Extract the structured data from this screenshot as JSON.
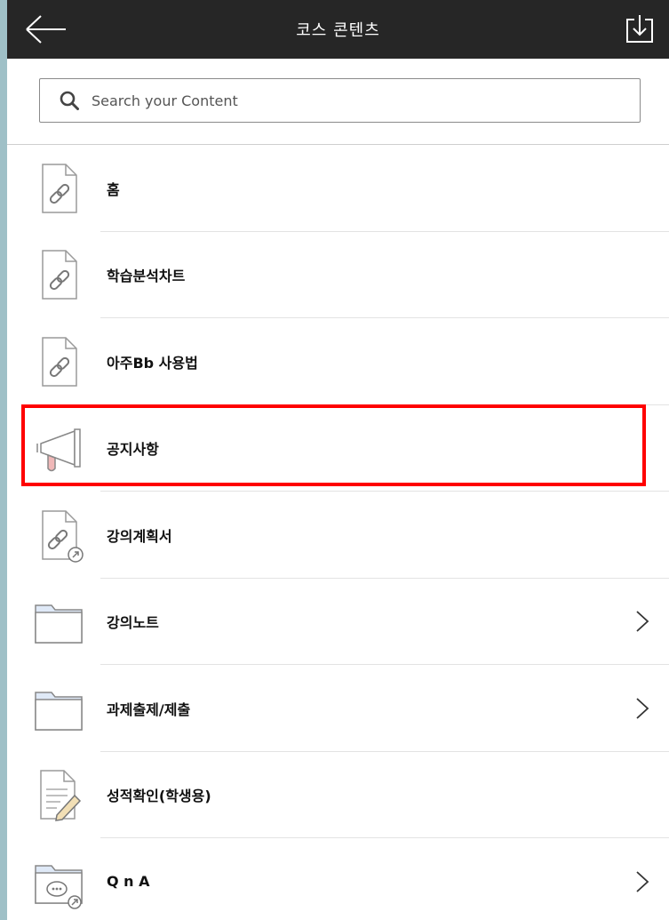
{
  "header": {
    "title": "코스 콘텐츠",
    "back_icon": "arrow-left-icon",
    "download_icon": "download-icon"
  },
  "search": {
    "placeholder": "Search your Content",
    "value": ""
  },
  "items": [
    {
      "label": "홈",
      "icon": "link-document-icon",
      "chevron": false
    },
    {
      "label": "학습분석차트",
      "icon": "link-document-icon",
      "chevron": false
    },
    {
      "label": "아주Bb 사용법",
      "icon": "link-document-icon",
      "chevron": false
    },
    {
      "label": "공지사항",
      "icon": "megaphone-icon",
      "chevron": false,
      "highlighted": true
    },
    {
      "label": "강의계획서",
      "icon": "link-document-badge-icon",
      "chevron": false
    },
    {
      "label": "강의노트",
      "icon": "folder-icon",
      "chevron": true
    },
    {
      "label": "과제출제/제출",
      "icon": "folder-icon",
      "chevron": true
    },
    {
      "label": "성적확인(학생용)",
      "icon": "edit-document-icon",
      "chevron": false
    },
    {
      "label": "Q n A",
      "icon": "chat-folder-icon",
      "chevron": true
    }
  ],
  "colors": {
    "header_bg": "#262626",
    "highlight": "#ff0000",
    "folder_fill": "#dfe9f7",
    "megaphone_accent": "#f0b8b8"
  }
}
